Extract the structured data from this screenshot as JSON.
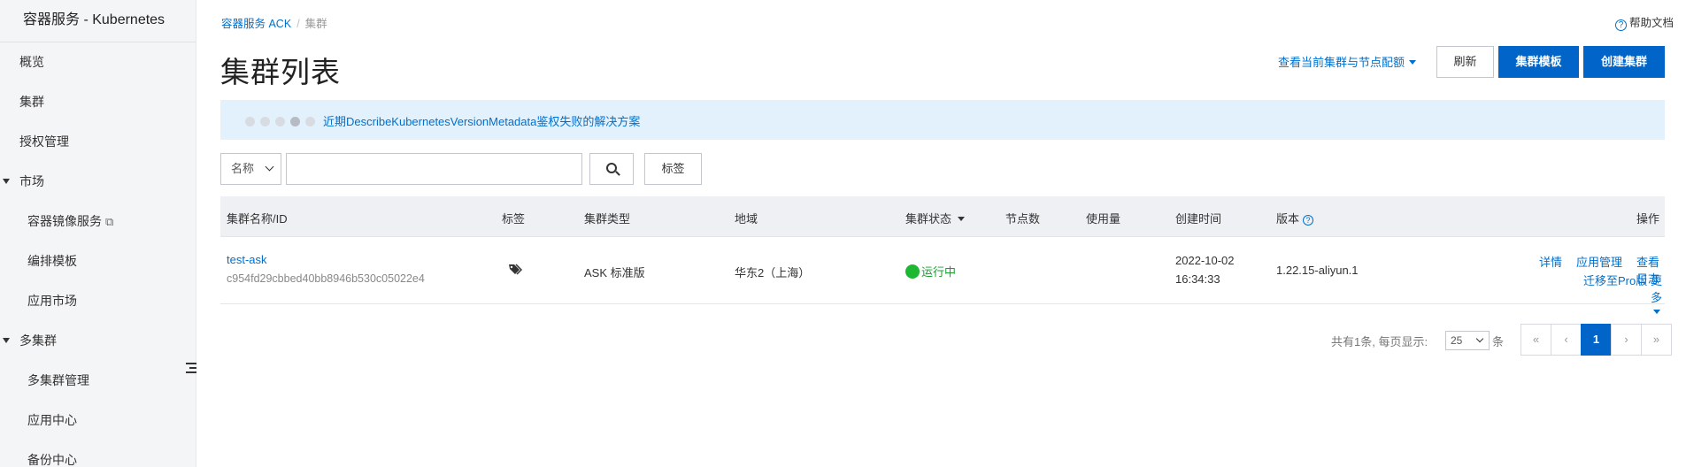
{
  "sidebar": {
    "title": "容器服务 - Kubernetes",
    "items": [
      {
        "label": "概览",
        "level": 0
      },
      {
        "label": "集群",
        "level": 0
      },
      {
        "label": "授权管理",
        "level": 0
      },
      {
        "label": "市场",
        "level": 0,
        "expandable": true
      },
      {
        "label": "容器镜像服务",
        "level": 1,
        "external": true
      },
      {
        "label": "编排模板",
        "level": 1
      },
      {
        "label": "应用市场",
        "level": 1
      },
      {
        "label": "多集群",
        "level": 0,
        "expandable": true
      },
      {
        "label": "多集群管理",
        "level": 1
      },
      {
        "label": "应用中心",
        "level": 1
      },
      {
        "label": "备份中心",
        "level": 1
      }
    ]
  },
  "breadcrumb": {
    "root": "容器服务 ACK",
    "current": "集群"
  },
  "help_label": "帮助文档",
  "page_title": "集群列表",
  "toolbar": {
    "quota_link": "查看当前集群与节点配额",
    "refresh": "刷新",
    "template": "集群模板",
    "create": "创建集群"
  },
  "notice": {
    "text": "近期DescribeKubernetesVersionMetadata鉴权失败的解决方案",
    "dots": 5,
    "active_dot": 4
  },
  "filter": {
    "field": "名称",
    "query": "",
    "tag_button": "标签"
  },
  "table": {
    "columns": {
      "name": "集群名称/ID",
      "tags": "标签",
      "type": "集群类型",
      "region": "地域",
      "status": "集群状态",
      "nodes": "节点数",
      "usage": "使用量",
      "created": "创建时间",
      "version": "版本",
      "actions": "操作"
    },
    "rows": [
      {
        "name": "test-ask",
        "id": "c954fd29cbbed40bb8946b530c05022e4",
        "type": "ASK 标准版",
        "region": "华东2（上海）",
        "status": "运行中",
        "status_color": "#1db832",
        "created_date": "2022-10-02",
        "created_time": "16:34:33",
        "version": "1.22.15-aliyun.1",
        "actions": {
          "details": "详情",
          "app_manage": "应用管理",
          "logs": "查看日志",
          "migrate": "迁移至Pro版",
          "more": "更多"
        }
      }
    ]
  },
  "pagination": {
    "info": "共有1条, 每页显示:",
    "page_size": "25",
    "unit": "条",
    "first": "«",
    "prev": "‹",
    "current": "1",
    "next": "›",
    "last": "»"
  },
  "colors": {
    "primary": "#0064c8",
    "link": "#0070cc",
    "running": "#1db832",
    "notice_bg": "#e3f1fd"
  }
}
